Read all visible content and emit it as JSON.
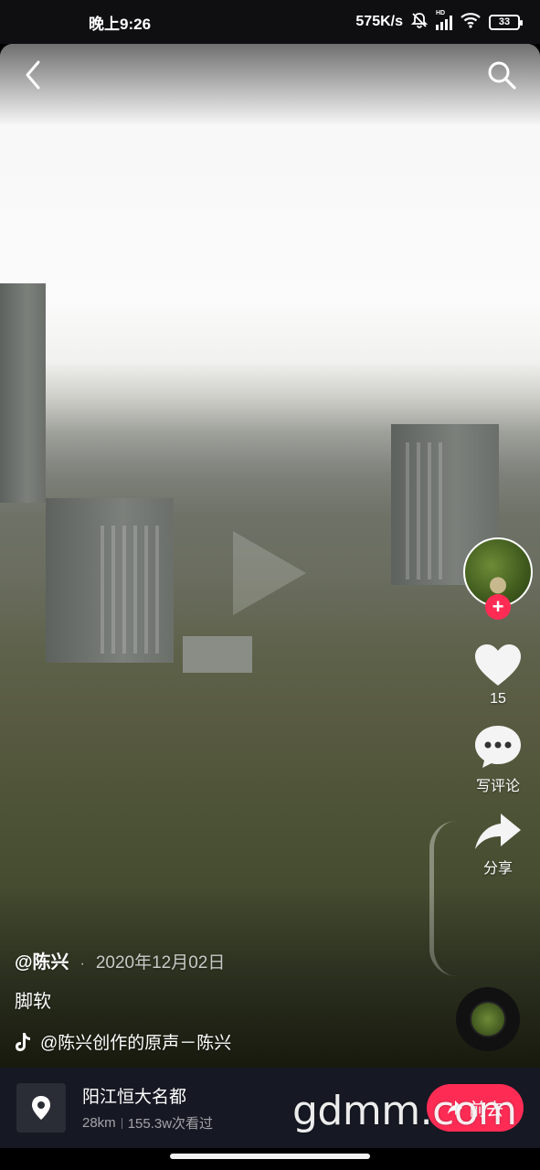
{
  "status_bar": {
    "time": "晚上9:26",
    "net_speed": "575K/s",
    "battery": "33",
    "network_badge": "HD",
    "icons": [
      "mute-bell-icon",
      "signal-icon",
      "wifi-icon",
      "battery-icon"
    ]
  },
  "header": {
    "back_icon": "chevron-left-icon",
    "search_icon": "search-icon"
  },
  "actions": {
    "follow_symbol": "+",
    "like_count": "15",
    "comment_label": "写评论",
    "share_label": "分享"
  },
  "post": {
    "author": "@陈兴",
    "separator": "·",
    "date": "2020年12月02日",
    "description": "脚软",
    "music": "@陈兴创作的原声－陈兴"
  },
  "location": {
    "name": "阳江恒大名都",
    "distance": "28km",
    "views": "155.3w次看过",
    "button_label": "前去"
  },
  "watermark": "gdmm.com",
  "colors": {
    "accent": "#fe2c55",
    "bar_bg": "#161823"
  }
}
